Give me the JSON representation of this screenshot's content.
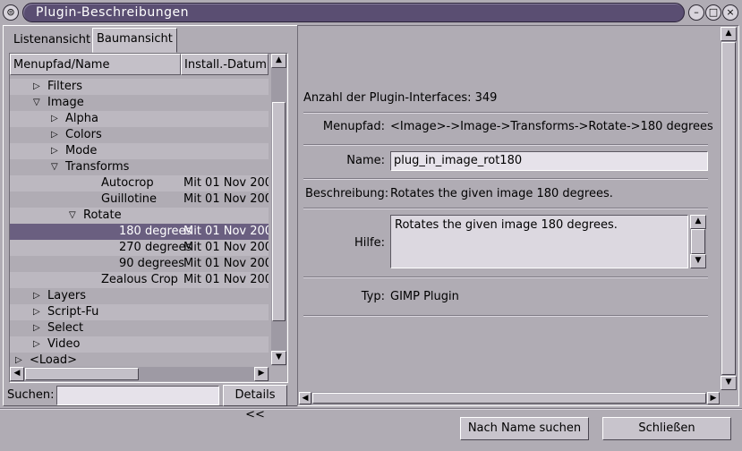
{
  "window": {
    "title": "Plugin-Beschreibungen",
    "buttons": {
      "menu": "⊜",
      "minimize": "–",
      "maximize": "□",
      "close": "×"
    }
  },
  "tabs": [
    {
      "label": "Listenansicht",
      "active": false
    },
    {
      "label": "Baumansicht",
      "active": true
    }
  ],
  "tree": {
    "columns": [
      "Menupfad/Name",
      "Install.-Datum"
    ],
    "rows": [
      {
        "label": "Filters",
        "date": "",
        "indent": 1,
        "expander": "right"
      },
      {
        "label": "Image",
        "date": "",
        "indent": 1,
        "expander": "down"
      },
      {
        "label": "Alpha",
        "date": "",
        "indent": 2,
        "expander": "right"
      },
      {
        "label": "Colors",
        "date": "",
        "indent": 2,
        "expander": "right"
      },
      {
        "label": "Mode",
        "date": "",
        "indent": 2,
        "expander": "right"
      },
      {
        "label": "Transforms",
        "date": "",
        "indent": 2,
        "expander": "down"
      },
      {
        "label": "Autocrop",
        "date": "Mit 01 Nov 200",
        "indent": 4,
        "expander": ""
      },
      {
        "label": "Guillotine",
        "date": "Mit 01 Nov 200",
        "indent": 4,
        "expander": ""
      },
      {
        "label": "Rotate",
        "date": "",
        "indent": 3,
        "expander": "down"
      },
      {
        "label": "180 degrees",
        "date": "Mit 01 Nov 200",
        "indent": 5,
        "expander": "",
        "selected": true
      },
      {
        "label": "270 degrees",
        "date": "Mit 01 Nov 200",
        "indent": 5,
        "expander": ""
      },
      {
        "label": "90 degrees",
        "date": "Mit 01 Nov 200",
        "indent": 5,
        "expander": ""
      },
      {
        "label": "Zealous Crop",
        "date": "Mit 01 Nov 200",
        "indent": 4,
        "expander": ""
      },
      {
        "label": "Layers",
        "date": "",
        "indent": 1,
        "expander": "right"
      },
      {
        "label": "Script-Fu",
        "date": "",
        "indent": 1,
        "expander": "right"
      },
      {
        "label": "Select",
        "date": "",
        "indent": 1,
        "expander": "right"
      },
      {
        "label": "Video",
        "date": "",
        "indent": 1,
        "expander": "right"
      },
      {
        "label": "<Load>",
        "date": "",
        "indent": 0,
        "expander": "right"
      }
    ]
  },
  "search": {
    "label": "Suchen:",
    "value": "",
    "details_button": "Details <<"
  },
  "details": {
    "count_text": "Anzahl der Plugin-Interfaces: 349",
    "menupath_label": "Menupfad:",
    "menupath_value": "<Image>->Image->Transforms->Rotate->180 degrees",
    "name_label": "Name:",
    "name_value": "plug_in_image_rot180",
    "desc_label": "Beschreibung:",
    "desc_value": "Rotates the given image 180 degrees.",
    "help_label": "Hilfe:",
    "help_value": "Rotates the given image 180 degrees.",
    "type_label": "Typ:",
    "type_value": "GIMP Plugin"
  },
  "footer": {
    "search_by_name": "Nach Name suchen",
    "close": "Schließen"
  }
}
